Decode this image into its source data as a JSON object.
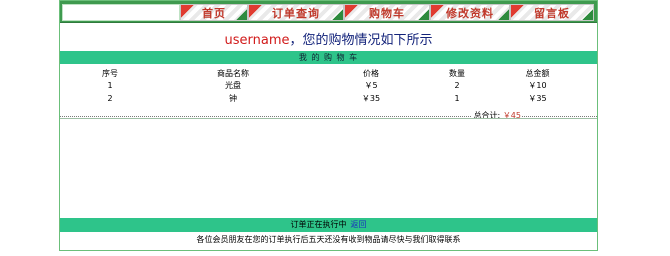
{
  "nav": {
    "tabs": [
      {
        "label": "首页"
      },
      {
        "label": "订单查询"
      },
      {
        "label": "购物车"
      },
      {
        "label": "修改资料"
      },
      {
        "label": "留言板"
      }
    ]
  },
  "headline": {
    "username": "username",
    "text": "，您的购物情况如下所示"
  },
  "cart": {
    "title": "我 的 购 物 车",
    "columns": [
      "序号",
      "商品名称",
      "价格",
      "数量",
      "总金额"
    ],
    "rows": [
      {
        "idx": "1",
        "name": "光盘",
        "price": "￥5",
        "qty": "2",
        "total": "￥10"
      },
      {
        "idx": "2",
        "name": "钟",
        "price": "￥35",
        "qty": "1",
        "total": "￥35"
      }
    ],
    "total_label": "总合计:",
    "total_value": "￥45"
  },
  "status": {
    "text": "订单正在执行中",
    "link": "返回"
  },
  "footer": {
    "text": "各位会员朋友在您的订单执行后五天还没有收到物品请尽快与我们取得联系"
  },
  "colors": {
    "accent_bar": "#2ec48a",
    "nav_bg": "#3f9a4f",
    "money": "#c0392b"
  }
}
